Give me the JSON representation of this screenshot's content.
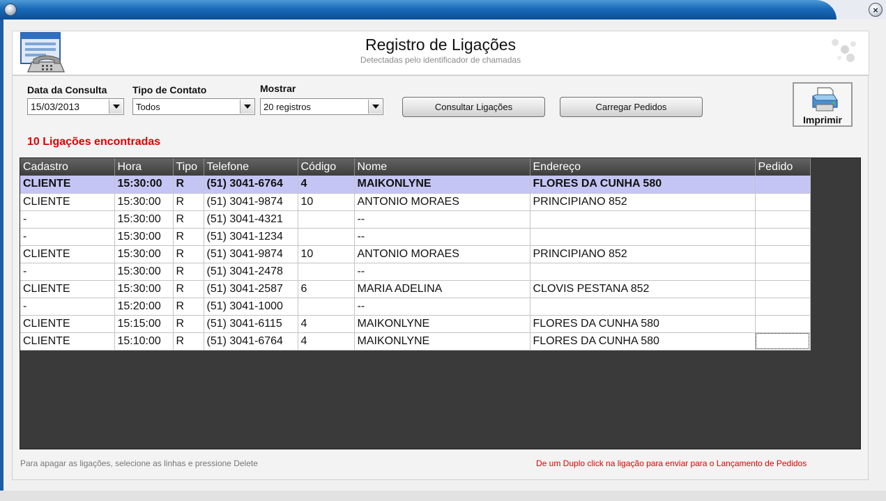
{
  "header": {
    "title": "Registro de Ligações",
    "subtitle": "Detectadas pelo identificador de chamadas"
  },
  "filters": {
    "date": {
      "label": "Data da Consulta",
      "value": "15/03/2013"
    },
    "contact_type": {
      "label": "Tipo de Contato",
      "value": "Todos"
    },
    "show": {
      "label": "Mostrar",
      "value": "20 registros"
    }
  },
  "buttons": {
    "consult": "Consultar Ligações",
    "load_orders": "Carregar Pedidos",
    "print": "Imprimir"
  },
  "count_label": "10 Ligações encontradas",
  "table": {
    "columns": [
      "Cadastro",
      "Hora",
      "Tipo",
      "Telefone",
      "Código",
      "Nome",
      "Endereço",
      "Pedido"
    ],
    "rows": [
      [
        "CLIENTE",
        "15:30:00",
        "R",
        "(51) 3041-6764",
        "4",
        "MAIKONLYNE",
        "FLORES DA CUNHA 580",
        ""
      ],
      [
        "CLIENTE",
        "15:30:00",
        "R",
        "(51) 3041-9874",
        "10",
        "ANTONIO MORAES",
        "PRINCIPIANO 852",
        ""
      ],
      [
        "-",
        "15:30:00",
        "R",
        "(51) 3041-4321",
        "",
        "--",
        "",
        ""
      ],
      [
        "-",
        "15:30:00",
        "R",
        "(51) 3041-1234",
        "",
        "--",
        "",
        ""
      ],
      [
        "CLIENTE",
        "15:30:00",
        "R",
        "(51) 3041-9874",
        "10",
        "ANTONIO MORAES",
        "PRINCIPIANO 852",
        ""
      ],
      [
        "-",
        "15:30:00",
        "R",
        "(51) 3041-2478",
        "",
        "--",
        "",
        ""
      ],
      [
        "CLIENTE",
        "15:30:00",
        "R",
        "(51) 3041-2587",
        "6",
        "MARIA  ADELINA",
        "CLOVIS PESTANA 852",
        ""
      ],
      [
        "-",
        "15:20:00",
        "R",
        "(51) 3041-1000",
        "",
        "--",
        "",
        ""
      ],
      [
        "CLIENTE",
        "15:15:00",
        "R",
        "(51) 3041-6115",
        "4",
        "MAIKONLYNE",
        "FLORES DA CUNHA 580",
        ""
      ],
      [
        "CLIENTE",
        "15:10:00",
        "R",
        "(51) 3041-6764",
        "4",
        "MAIKONLYNE",
        "FLORES DA CUNHA 580",
        ""
      ]
    ],
    "selected_row": 0
  },
  "hints": {
    "left": "Para apagar as ligações, selecione as linhas e pressione Delete",
    "right": "De um Duplo click na ligação para enviar para o Lançamento de Pedidos"
  },
  "colors": {
    "accent_red": "#e00000",
    "title_bar_blue": "#1a6ab8",
    "selected_row": "#c5c5f5",
    "grid_background": "#3a3a3a"
  },
  "icons": {
    "window": "system-menu-icon",
    "close": "close-icon",
    "app": "call-log-icon",
    "print": "printer-icon"
  }
}
